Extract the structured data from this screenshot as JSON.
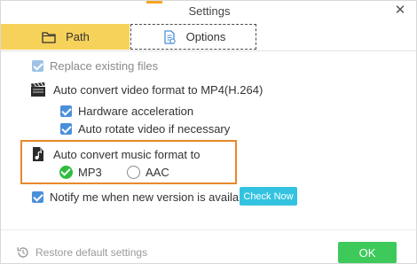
{
  "window": {
    "title": "Settings",
    "close_glyph": "✕"
  },
  "tabs": [
    {
      "label": "Path",
      "icon": "folder-icon",
      "active": false
    },
    {
      "label": "Options",
      "icon": "document-settings-icon",
      "active": true
    }
  ],
  "options": {
    "replace_existing": {
      "label": "Replace existing files",
      "checked": true,
      "disabled": true
    },
    "video_section": {
      "label": "Auto convert video format to MP4(H.264)",
      "icon": "video-clapper-icon"
    },
    "hardware_accel": {
      "label": "Hardware acceleration",
      "checked": true
    },
    "auto_rotate": {
      "label": "Auto rotate video if necessary",
      "checked": true
    },
    "music_section": {
      "label": "Auto convert music format to",
      "icon": "music-file-icon"
    },
    "music_formats": [
      {
        "label": "MP3",
        "selected": true
      },
      {
        "label": "AAC",
        "selected": false
      }
    ],
    "notify": {
      "label": "Notify me when new version is available",
      "checked": true
    },
    "check_now_label": "Check Now"
  },
  "footer": {
    "restore_label": "Restore default settings",
    "ok_label": "OK"
  },
  "colors": {
    "path_tab": "#f7d25a",
    "highlight_border": "#e8892b",
    "checkbox": "#4a90d9",
    "check_now": "#33c3e0",
    "ok": "#3dca5b",
    "radio_selected": "#2ebd3d"
  }
}
